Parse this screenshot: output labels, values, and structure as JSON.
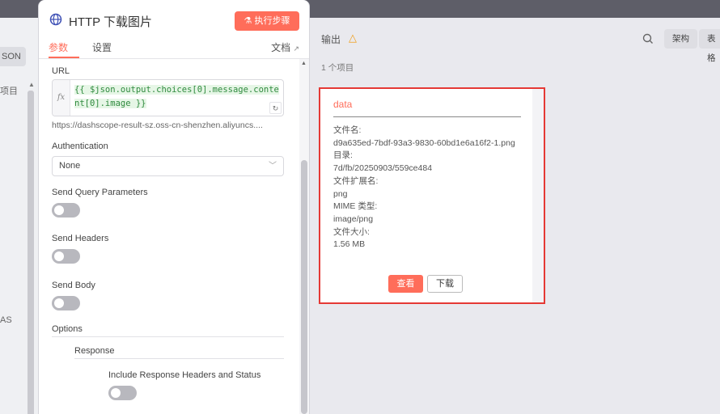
{
  "left_panel": {
    "json_label": "SON",
    "items_label": "项目",
    "as_label": "AS"
  },
  "params_panel": {
    "title": "HTTP 下载图片",
    "execute_label": "执行步骤",
    "tabs": [
      "参数",
      "设置"
    ],
    "docs_label": "文档",
    "url": {
      "label": "URL",
      "fx": "fx",
      "expression": "{{ $json.output.choices[0].message.content[0].image }}",
      "preview": "https://dashscope-result-sz.oss-cn-shenzhen.aliyuncs...."
    },
    "authentication": {
      "label": "Authentication",
      "value": "None"
    },
    "send_query": {
      "label": "Send Query Parameters",
      "enabled": false
    },
    "send_headers": {
      "label": "Send Headers",
      "enabled": false
    },
    "send_body": {
      "label": "Send Body",
      "enabled": false
    },
    "options": {
      "label": "Options",
      "response_label": "Response",
      "include_headers": {
        "label": "Include Response Headers and Status",
        "enabled": false
      }
    }
  },
  "output_panel": {
    "title": "输出",
    "items_count": "1 个项目",
    "views": [
      "架构",
      "表格"
    ]
  },
  "data_card": {
    "title": "data",
    "file_name_label": "文件名:",
    "file_name": "d9a635ed-7bdf-93a3-9830-60bd1e6a16f2-1.png",
    "dir_label": "目录:",
    "dir": "7d/fb/20250903/559ce484",
    "ext_label": "文件扩展名:",
    "ext": "png",
    "mime_label": "MIME 类型:",
    "mime": "image/png",
    "size_label": "文件大小:",
    "size": "1.56 MB",
    "view_label": "查看",
    "download_label": "下载"
  },
  "colors": {
    "accent": "#ff6d5a",
    "highlight_border": "#e53935",
    "warning": "#f0a020"
  }
}
